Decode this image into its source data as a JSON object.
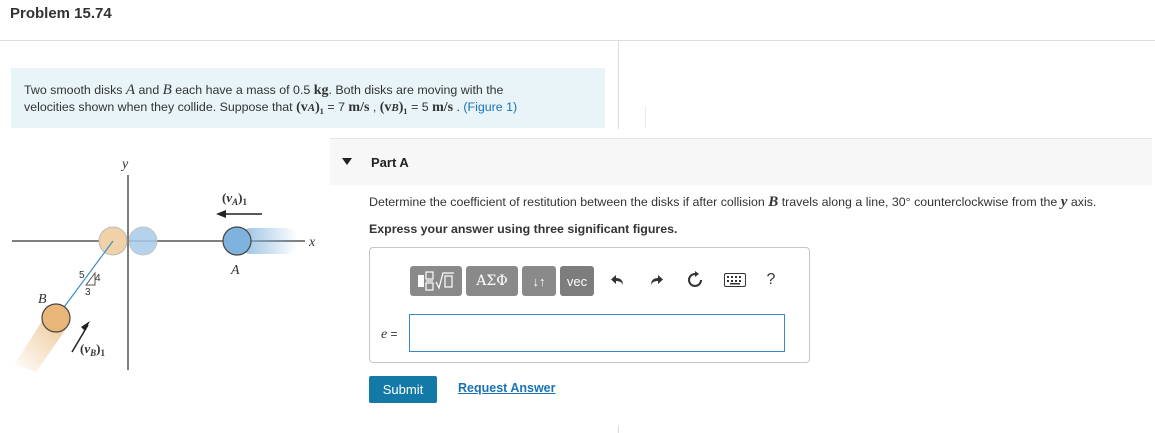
{
  "header": {
    "title": "Problem 15.74"
  },
  "statement": {
    "line1_pre": "Two smooth disks ",
    "disk_a": "A",
    "line1_and": " and ",
    "disk_b": "B",
    "line1_mid": " each have a mass of 0.5 ",
    "mass_unit": "kg",
    "line1_post": ". Both disks are moving with the",
    "line2_pre": "velocities shown when they collide. Suppose that ",
    "va_symbol": "(v",
    "va_sub": "A",
    "va_close": ")₁",
    "va_eq": " = 7 ",
    "speed_unit": "m/s",
    "sep": " , ",
    "vb_symbol": "(v",
    "vb_sub": "B",
    "vb_close": ")₁",
    "vb_eq": " = 5 ",
    "speed_unit2": "m/s",
    "line2_post": " . ",
    "figure_link": "(Figure 1)"
  },
  "figure": {
    "y_axis_label": "y",
    "x_axis_label": "x",
    "va_label": "(vA)1",
    "disk_a_label": "A",
    "disk_b_label": "B",
    "vb_label": "(vB)1",
    "slope_hyp": "5",
    "slope_rise": "4",
    "slope_run": "3",
    "disk_a_color": "#a8cbe8",
    "disk_b_color": "#f1d2a8"
  },
  "part": {
    "label": "Part A",
    "question_pre": "Determine the coefficient of restitution between the disks if after collision ",
    "question_b": "B",
    "question_mid": " travels along a line, 30° counterclockwise from the ",
    "question_y": "y",
    "question_post": " axis.",
    "instruction": "Express your answer using three significant figures."
  },
  "toolbar": {
    "templates_icon": "fraction-sqrt-icon",
    "greek_label": "ΑΣΦ",
    "arrows_label": "↓↑",
    "vec_label": "vec",
    "undo_icon": "undo-icon",
    "redo_icon": "redo-icon",
    "reset_icon": "reset-icon",
    "keyboard_icon": "keyboard-icon",
    "help_label": "?"
  },
  "answer": {
    "variable": "e",
    "equals": " =",
    "value": ""
  },
  "actions": {
    "submit_label": "Submit",
    "request_label": "Request Answer"
  },
  "colors": {
    "accent": "#137aa8",
    "link": "#1a73b5",
    "statement_bg": "#e8f4f7"
  }
}
